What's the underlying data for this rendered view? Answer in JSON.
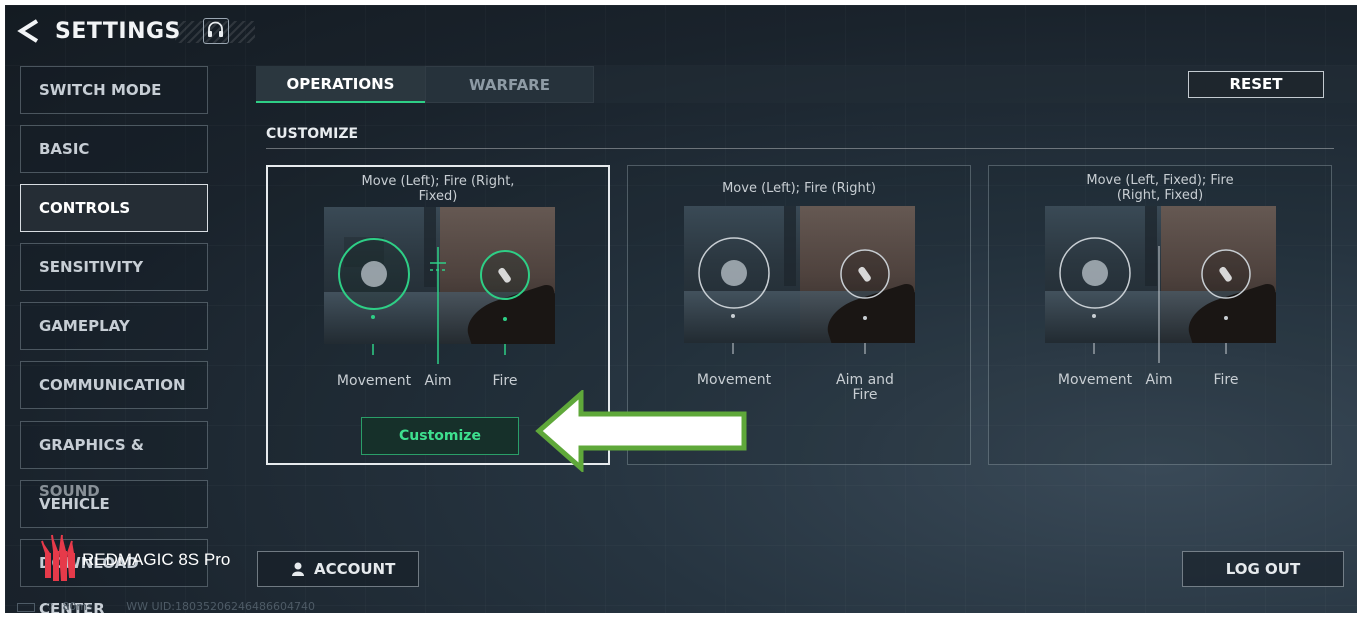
{
  "header": {
    "title": "SETTINGS"
  },
  "sidebar": {
    "items": [
      {
        "label": "SWITCH MODE"
      },
      {
        "label": "BASIC"
      },
      {
        "label": "CONTROLS",
        "active": true
      },
      {
        "label": "SENSITIVITY"
      },
      {
        "label": "GAMEPLAY"
      },
      {
        "label": "COMMUNICATION"
      },
      {
        "label": "GRAPHICS & SOUND"
      },
      {
        "label": "VEHICLE"
      },
      {
        "label": "DOWNLOAD CENTER"
      }
    ]
  },
  "tabs": [
    {
      "label": "OPERATIONS",
      "active": true
    },
    {
      "label": "WARFARE",
      "active": false
    }
  ],
  "reset_label": "RESET",
  "section_title": "CUSTOMIZE",
  "cards": [
    {
      "title": "Move (Left); Fire (Right, Fixed)",
      "title_l1": "Move (Left); Fire (Right,",
      "title_l2": "Fixed)",
      "labels": [
        "Movement",
        "Aim",
        "Fire"
      ],
      "selected": true,
      "button": "Customize"
    },
    {
      "title": "Move (Left); Fire (Right)",
      "labels": [
        "Movement",
        "Aim and Fire"
      ],
      "label2_l1": "Aim and",
      "label2_l2": "Fire",
      "selected": false
    },
    {
      "title": "Move (Left, Fixed); Fire (Right, Fixed)",
      "title_l1": "Move (Left, Fixed); Fire",
      "title_l2": "(Right, Fixed)",
      "labels": [
        "Movement",
        "Aim",
        "Fire"
      ],
      "selected": false
    }
  ],
  "bottom": {
    "account_label": "ACCOUNT",
    "logout_label": "LOG OUT"
  },
  "status_bar": {
    "ping": "80ms",
    "uid": "WW UID:18035206246486604740"
  },
  "watermark": {
    "text": "REDMAGIC 8S Pro"
  },
  "colors": {
    "accent_green": "#2ecf86",
    "annotation_arrow": "#5fa83a"
  },
  "icons": {
    "back": "chevron-left-icon",
    "support": "headset-icon",
    "account": "person-icon"
  }
}
